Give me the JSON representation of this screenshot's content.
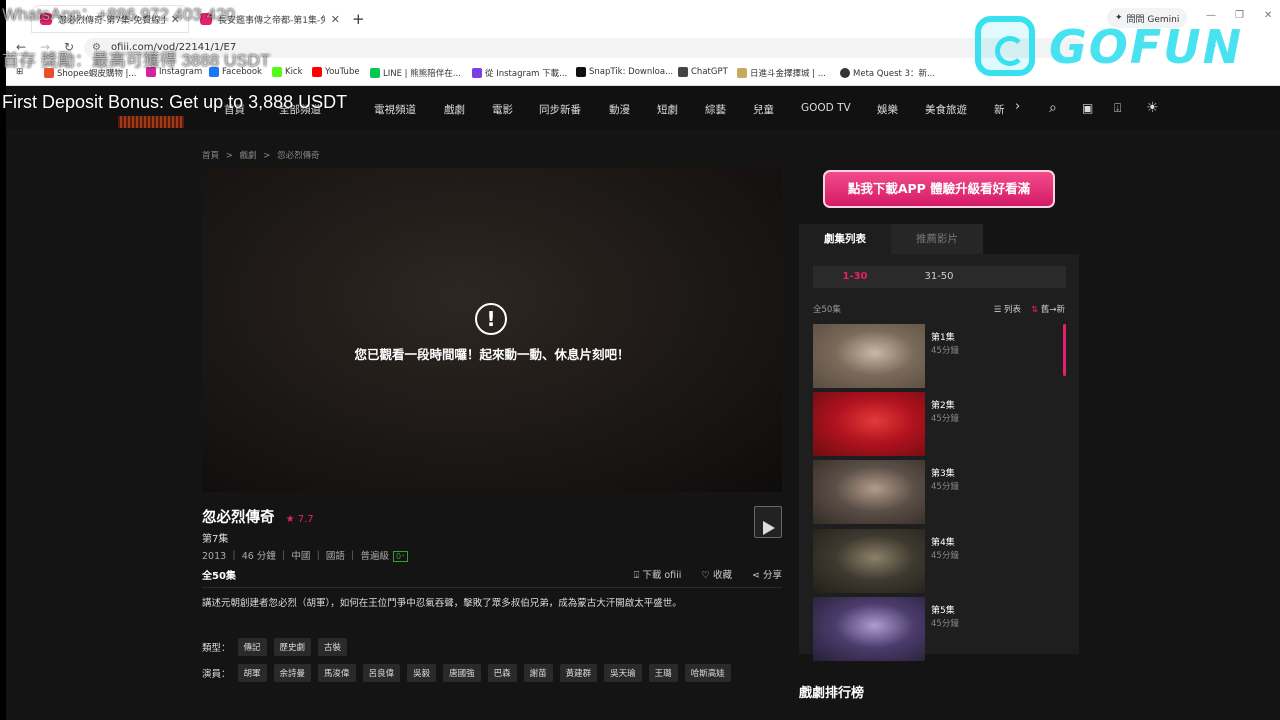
{
  "browser": {
    "tabs": [
      {
        "title": "忽必烈傳奇-第7集-免費線上看",
        "active": true
      },
      {
        "title": "長安鑑事傳之帝都-第1集-免費線上看",
        "active": false
      }
    ],
    "new_tab": "+",
    "gemini": "問問 Gemini",
    "url": "ofiii.com/vod/22141/1/E7",
    "bookmarks": [
      {
        "label": "Shopee蝦皮購物 |...",
        "color": "#ee4d2d"
      },
      {
        "label": "Instagram",
        "color": "#d6249f"
      },
      {
        "label": "Facebook",
        "color": "#1877f2"
      },
      {
        "label": "Kick",
        "color": "#53fc18"
      },
      {
        "label": "YouTube",
        "color": "#ff0000"
      },
      {
        "label": "LINE | 熊熊陪伴在...",
        "color": "#06c755"
      },
      {
        "label": "從 Instagram 下載...",
        "color": "#7b3fe4"
      },
      {
        "label": "SnapTik: Downloa...",
        "color": "#111111"
      },
      {
        "label": "ChatGPT",
        "color": "#444444"
      },
      {
        "label": "日進斗金擇擇城 | ...",
        "color": "#c8a85a"
      },
      {
        "label": "Meta Quest 3：新...",
        "color": "#333333"
      }
    ]
  },
  "site": {
    "nav": [
      "首頁",
      "全部頻道",
      "電視頻道",
      "戲劇",
      "電影",
      "同步新番",
      "動漫",
      "短劇",
      "綜藝",
      "兒童",
      "GOOD TV",
      "娛樂",
      "美食旅遊",
      "新"
    ],
    "nav_more": "›"
  },
  "breadcrumb": [
    "首頁",
    ">",
    "戲劇",
    ">",
    "忽必烈傳奇"
  ],
  "player": {
    "message": "您已觀看一段時間囉！起來動一動、休息片刻吧！"
  },
  "show": {
    "title": "忽必烈傳奇",
    "rating": "★ 7.7",
    "episode": "第7集",
    "meta": "2013 ｜ 46 分鐘 ｜ 中國 ｜ 國語 ｜ 普遍級",
    "age_badge": "0⁺",
    "total": "全50集",
    "actions": {
      "download": "下載 ofiii",
      "favorite": "收藏",
      "share": "分享"
    },
    "description": "講述元朝創建者忽必烈（胡軍），如何在王位鬥爭中忍氣吞聲，擊敗了眾多叔伯兄弟，成為蒙古大汗開啟太平盛世。",
    "genre_label": "類型：",
    "genres": [
      "傳記",
      "歷史劇",
      "古裝"
    ],
    "cast_label": "演員：",
    "cast": [
      "胡軍",
      "余詩曼",
      "馬浚偉",
      "呂良偉",
      "吳毅",
      "唐國強",
      "巴森",
      "謝苗",
      "黃建群",
      "吳天瑜",
      "王璐",
      "哈斯高娃"
    ]
  },
  "sidebar": {
    "app_button": "點我下載APP 體驗升級看好看滿",
    "tabs": [
      "劇集列表",
      "推薦影片"
    ],
    "ranges": [
      "1-30",
      "31-50"
    ],
    "count": "全50集",
    "list_label": "列表",
    "sort_label": "舊→新",
    "episodes": [
      {
        "label": "第1集",
        "duration": "45分鐘",
        "colors": [
          "#7a6a5a",
          "#c9b8a6",
          "#5a4c41"
        ]
      },
      {
        "label": "第2集",
        "duration": "45分鐘",
        "colors": [
          "#b0121e",
          "#e23a3a",
          "#6d0d12"
        ]
      },
      {
        "label": "第3集",
        "duration": "45分鐘",
        "colors": [
          "#5b5048",
          "#b39b8a",
          "#332b25"
        ]
      },
      {
        "label": "第4集",
        "duration": "45分鐘",
        "colors": [
          "#3f3a30",
          "#8c8168",
          "#221f19"
        ]
      },
      {
        "label": "第5集",
        "duration": "45分鐘",
        "colors": [
          "#4b3c6c",
          "#b09bd0",
          "#261e36"
        ]
      }
    ],
    "ranking_title": "戲劇排行榜"
  },
  "overlay": {
    "brand": "GOFUN",
    "line1": "WhatsApp：+886 972 403 420",
    "line2": "首存 獎勵：最高可獲得 3888 USDT",
    "line3": "First Deposit Bonus: Get up to 3,888 USDT"
  },
  "colors": {
    "accent": "#e4206c",
    "brand": "#39e0f0"
  }
}
